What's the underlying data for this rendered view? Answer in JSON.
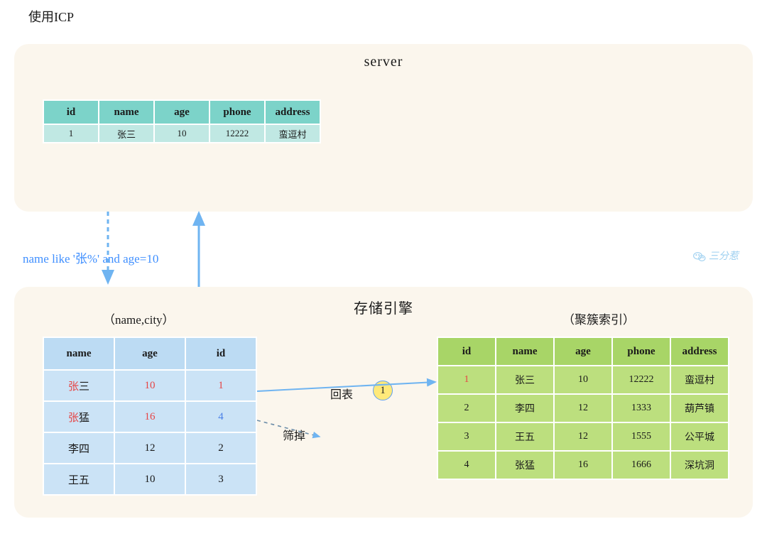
{
  "title": "使用ICP",
  "signature": "三分惹",
  "server": {
    "title": "server"
  },
  "storage": {
    "title": "存储引擎"
  },
  "condition_label": "name like '张%' and age=10",
  "left_index_label": "（name,city）",
  "right_index_label": "（聚簇索引）",
  "huibiao_label": "回表",
  "shaidiao_label": "筛掉",
  "circle_badge": "1",
  "server_table": {
    "headers": [
      "id",
      "name",
      "age",
      "phone",
      "address"
    ],
    "rows": [
      [
        "1",
        "张三",
        "10",
        "12222",
        "蛮逗村"
      ]
    ]
  },
  "secondary_index": {
    "headers": [
      "name",
      "age",
      "id"
    ],
    "rows": [
      {
        "name": "张三",
        "age": "10",
        "id": "1",
        "name_prefix_red": "张",
        "name_suffix": "三",
        "age_red": true,
        "id_red": true
      },
      {
        "name": "张猛",
        "age": "16",
        "id": "4",
        "name_prefix_red": "张",
        "name_suffix": "猛",
        "age_red": true,
        "id_blue": true
      },
      {
        "name": "李四",
        "age": "12",
        "id": "2"
      },
      {
        "name": "王五",
        "age": "10",
        "id": "3"
      }
    ]
  },
  "clustered_index": {
    "headers": [
      "id",
      "name",
      "age",
      "phone",
      "address"
    ],
    "rows": [
      {
        "id": "1",
        "name": "张三",
        "age": "10",
        "phone": "12222",
        "address": "蛮逗村",
        "id_red": true
      },
      {
        "id": "2",
        "name": "李四",
        "age": "12",
        "phone": "1333",
        "address": "葫芦镇"
      },
      {
        "id": "3",
        "name": "王五",
        "age": "12",
        "phone": "1555",
        "address": "公平城"
      },
      {
        "id": "4",
        "name": "张猛",
        "age": "16",
        "phone": "1666",
        "address": "深坑洞"
      }
    ]
  }
}
